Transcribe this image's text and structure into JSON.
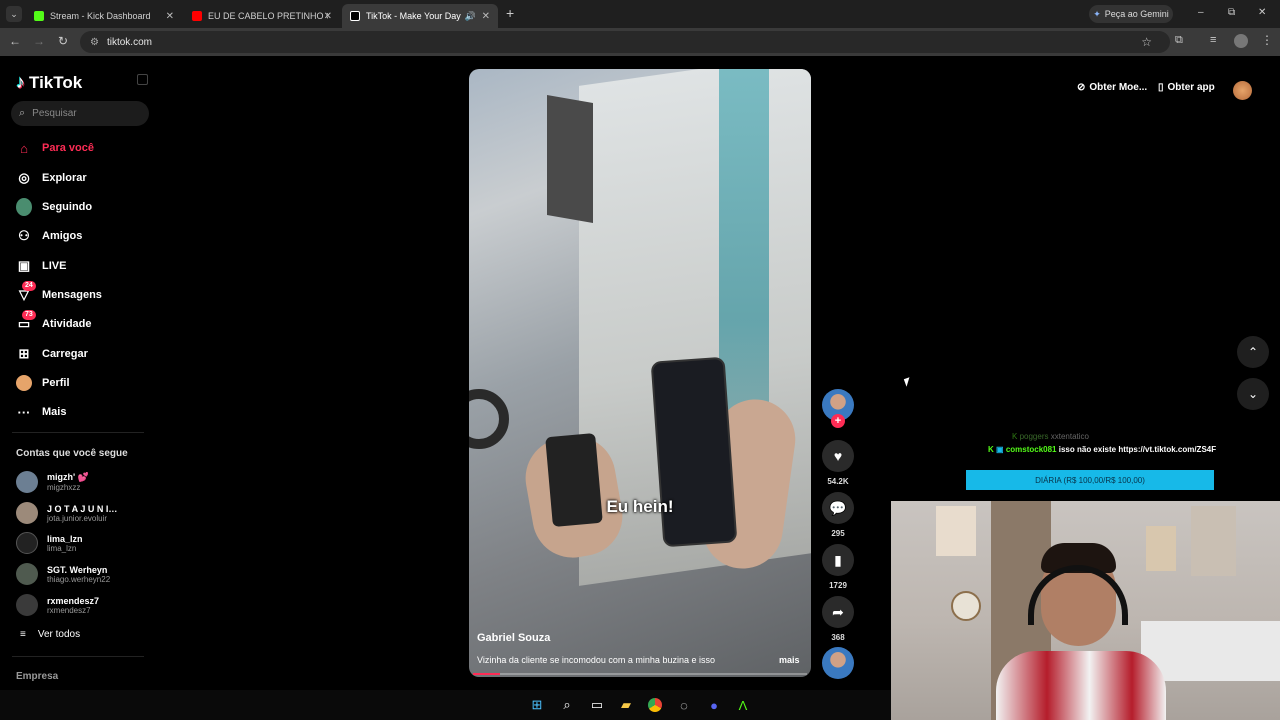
{
  "browser": {
    "tabs": [
      {
        "label": "Stream - Kick Dashboard",
        "color": "#53fc18"
      },
      {
        "label": "EU DE CABELO PRETINHO OU L",
        "color": "#ff0000"
      },
      {
        "label": "TikTok - Make Your Day",
        "color": "#ffffff"
      }
    ],
    "new_tab": "+",
    "gemini": "Peça ao Gemini",
    "url": "tiktok.com",
    "window_controls": {
      "minimize": "–",
      "maximize": "⧉",
      "close": "✕"
    }
  },
  "sidebar": {
    "logo": "TikTok",
    "search_placeholder": "Pesquisar",
    "nav": [
      {
        "label": "Para você",
        "icon": "home-icon",
        "active": true
      },
      {
        "label": "Explorar",
        "icon": "compass-icon"
      },
      {
        "label": "Seguindo",
        "icon": "following-icon"
      },
      {
        "label": "Amigos",
        "icon": "friends-icon"
      },
      {
        "label": "LIVE",
        "icon": "live-icon"
      },
      {
        "label": "Mensagens",
        "icon": "messages-icon",
        "badge": "24"
      },
      {
        "label": "Atividade",
        "icon": "activity-icon",
        "badge": "73"
      },
      {
        "label": "Carregar",
        "icon": "upload-icon"
      },
      {
        "label": "Perfil",
        "icon": "profile-icon"
      },
      {
        "label": "Mais",
        "icon": "more-icon"
      }
    ],
    "following_title": "Contas que você segue",
    "accounts": [
      {
        "name": "migzh' 💕",
        "handle": "migzhxzz",
        "color": "#6c7f93"
      },
      {
        "name": "J O T A  J U N I…",
        "handle": "jota.junior.evoluir",
        "color": "#9c8a7a"
      },
      {
        "name": "lima_lzn",
        "handle": "lima_lzn",
        "color": "#222222"
      },
      {
        "name": "SGT. Werheyn",
        "handle": "thiago.werheyn22",
        "color": "#4f5a4f"
      },
      {
        "name": "rxmendesz7",
        "handle": "rxmendesz7",
        "color": "#3a3a3a"
      }
    ],
    "see_all": "Ver todos",
    "footer": "Empresa"
  },
  "header": {
    "coins": "Obter Moe...",
    "app": "Obter app"
  },
  "video": {
    "subtitle": "Eu hein!",
    "author": "Gabriel Souza",
    "caption": "Vizinha da cliente se incomodou com a minha buzina e isso",
    "more": "mais",
    "progress": 0.08
  },
  "actions": {
    "likes": "54.2K",
    "comments": "295",
    "saves": "1729",
    "shares": "368"
  },
  "stream_overlay": {
    "chat1_user": "poggers",
    "chat1_text": "xxtentatico",
    "chat2_user": "comstock081",
    "chat2_text": "isso não existe https://vt.tiktok.com/ZS4F",
    "goal": "DIÁRIA (R$ 100,00/R$ 100,00)"
  },
  "colors": {
    "accent": "#fe2c55",
    "kick": "#53fc18",
    "goal": "#17b9e8"
  }
}
